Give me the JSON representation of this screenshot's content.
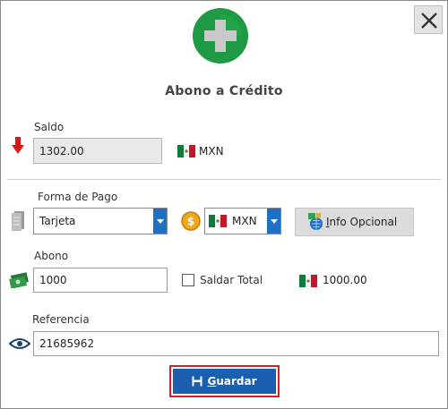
{
  "dialog": {
    "title": "Abono a Crédito",
    "close_icon": "close-icon",
    "logo_icon": "plus-circle-icon",
    "colors": {
      "accent": "#1a5fb0",
      "logo_green": "#1e9a45",
      "highlight": "#d0202a"
    }
  },
  "saldo": {
    "label": "Saldo",
    "value": "1302.00",
    "currency": "MXN",
    "icon": "arrow-down-icon"
  },
  "forma_pago": {
    "label": "Forma de Pago",
    "selected": "Tarjeta",
    "currency_selected": "MXN",
    "info_button_prefix": "I",
    "info_button_rest": "nfo Opcional"
  },
  "abono": {
    "label": "Abono",
    "value": "1000",
    "saldar_total_label": "Saldar Total",
    "saldar_total_checked": false,
    "total_amount": "1000.00"
  },
  "referencia": {
    "label": "Referencia",
    "value": "21685962"
  },
  "footer": {
    "save_prefix": "G",
    "save_rest": "uardar"
  }
}
